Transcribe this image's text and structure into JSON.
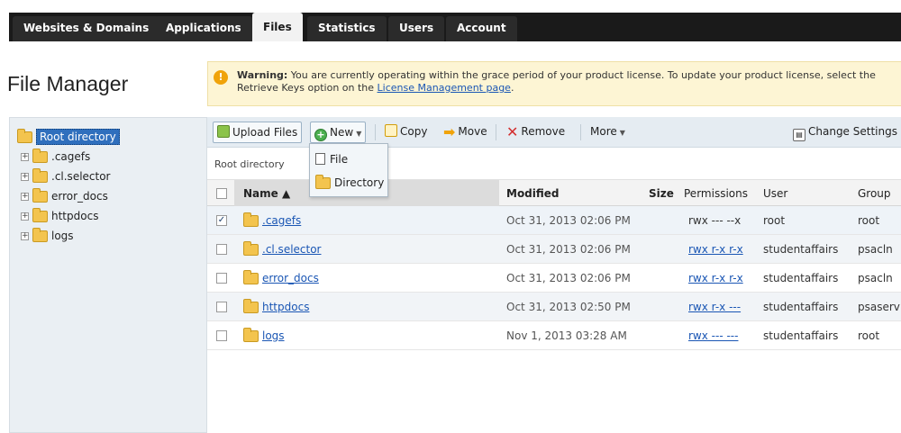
{
  "tabs": [
    {
      "label": "Websites & Domains",
      "active": false
    },
    {
      "label": "Applications",
      "active": false
    },
    {
      "label": "Files",
      "active": true
    },
    {
      "label": "Statistics",
      "active": false
    },
    {
      "label": "Users",
      "active": false
    },
    {
      "label": "Account",
      "active": false
    }
  ],
  "page_title": "File Manager",
  "warning": {
    "icon": "!",
    "lead": "Warning:",
    "text": " You are currently operating within the grace period of your product license. To update your product license, select the Retrieve Keys option on the ",
    "link": "License Management page",
    "tail": "."
  },
  "sidebar": {
    "root": "Root directory",
    "items": [
      ".cagefs",
      ".cl.selector",
      "error_docs",
      "httpdocs",
      "logs"
    ]
  },
  "toolbar": {
    "upload": "Upload Files",
    "new": "New",
    "copy": "Copy",
    "move": "Move",
    "remove": "Remove",
    "more": "More",
    "change_settings": "Change Settings"
  },
  "new_menu": {
    "file": "File",
    "directory": "Directory"
  },
  "breadcrumb": "Root directory",
  "table": {
    "columns": {
      "name": "Name ▲",
      "modified": "Modified",
      "size": "Size",
      "permissions": "Permissions",
      "user": "User",
      "group": "Group"
    },
    "rows": [
      {
        "name": ".cagefs",
        "modified": "Oct 31, 2013 02:06 PM",
        "size": "",
        "permissions": "rwx --- --x",
        "perm_link": false,
        "user": "root",
        "group": "root",
        "checked": "✓"
      },
      {
        "name": ".cl.selector",
        "modified": "Oct 31, 2013 02:06 PM",
        "size": "",
        "permissions": "rwx r-x r-x",
        "perm_link": true,
        "user": "studentaffairs",
        "group": "psacln",
        "checked": ""
      },
      {
        "name": "error_docs",
        "modified": "Oct 31, 2013 02:06 PM",
        "size": "",
        "permissions": "rwx r-x r-x",
        "perm_link": true,
        "user": "studentaffairs",
        "group": "psacln",
        "checked": ""
      },
      {
        "name": "httpdocs",
        "modified": "Oct 31, 2013 02:50 PM",
        "size": "",
        "permissions": "rwx r-x ---",
        "perm_link": true,
        "user": "studentaffairs",
        "group": "psaserv",
        "checked": ""
      },
      {
        "name": "logs",
        "modified": "Nov 1, 2013 03:28 AM",
        "size": "",
        "permissions": "rwx --- ---",
        "perm_link": true,
        "user": "studentaffairs",
        "group": "root",
        "checked": ""
      }
    ]
  }
}
